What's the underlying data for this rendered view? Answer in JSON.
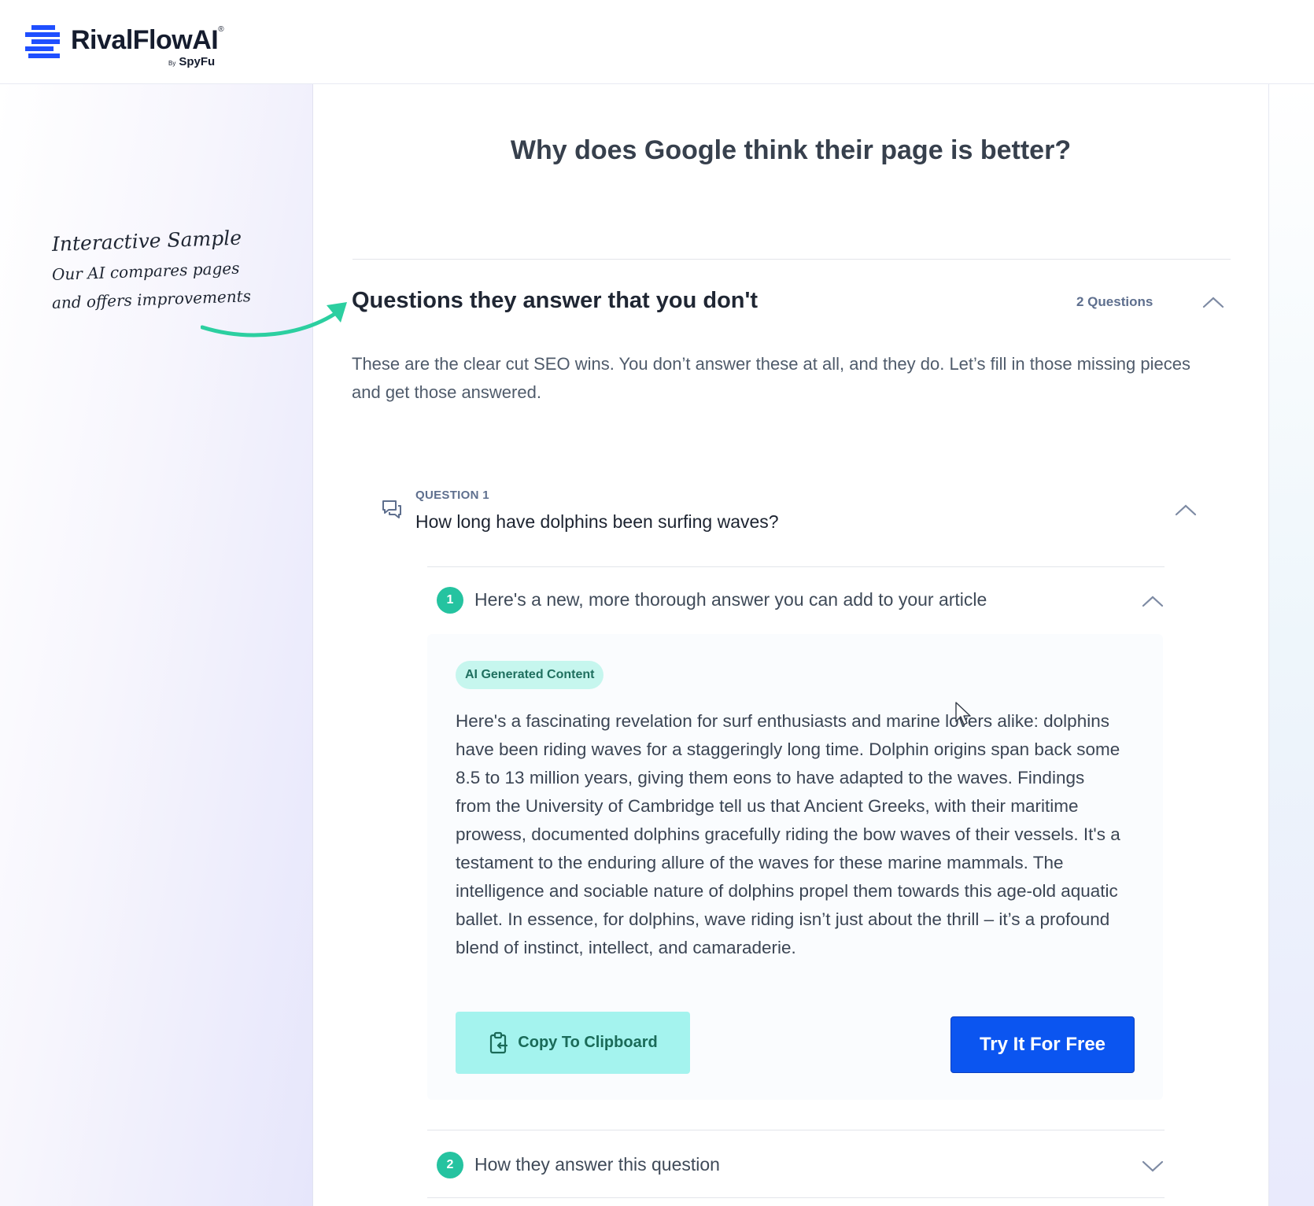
{
  "brand": {
    "name": "RivalFlowAI",
    "registered": "®",
    "by_prefix": "By",
    "by_name": "SpyFu"
  },
  "annotation": {
    "title": "Interactive Sample",
    "line1": "Our AI compares pages",
    "line2": "and offers improvements"
  },
  "main": {
    "title": "Why does Google think their page is better?",
    "section": {
      "title": "Questions they answer that you don't",
      "count_label": "2 Questions",
      "description": "These are the clear cut SEO wins. You don’t answer these at all, and they do. Let’s fill in those missing pieces and get those answered."
    },
    "question": {
      "label": "QUESTION 1",
      "text": "How long have dolphins been surfing waves?",
      "steps": [
        {
          "number": "1",
          "label": "Here's a new, more thorough answer you can add to your article",
          "expanded": true
        },
        {
          "number": "2",
          "label": "How they answer this question",
          "expanded": false
        }
      ],
      "answer": {
        "pill": "AI Generated Content",
        "body": "Here's a fascinating revelation for surf enthusiasts and marine lovers alike: dolphins have been riding waves for a staggeringly long time. Dolphin origins span back some 8.5 to 13 million years, giving them eons to have adapted to the waves. Findings from the University of Cambridge tell us that Ancient Greeks, with their maritime prowess, documented dolphins gracefully riding the bow waves of their vessels. It's a testament to the enduring allure of the waves for these marine mammals. The intelligence and sociable nature of dolphins propel them towards this age-old aquatic ballet. In essence, for dolphins, wave riding isn’t just about the thrill – it’s a profound blend of instinct, intellect, and camaraderie.",
        "copy_button": "Copy To Clipboard",
        "cta_button": "Try It For Free"
      }
    }
  },
  "colors": {
    "accent_teal": "#25c3a0",
    "cta_blue": "#0b55f0",
    "brand_blue": "#1f4fff",
    "copy_button_bg": "#a4f3ee"
  }
}
